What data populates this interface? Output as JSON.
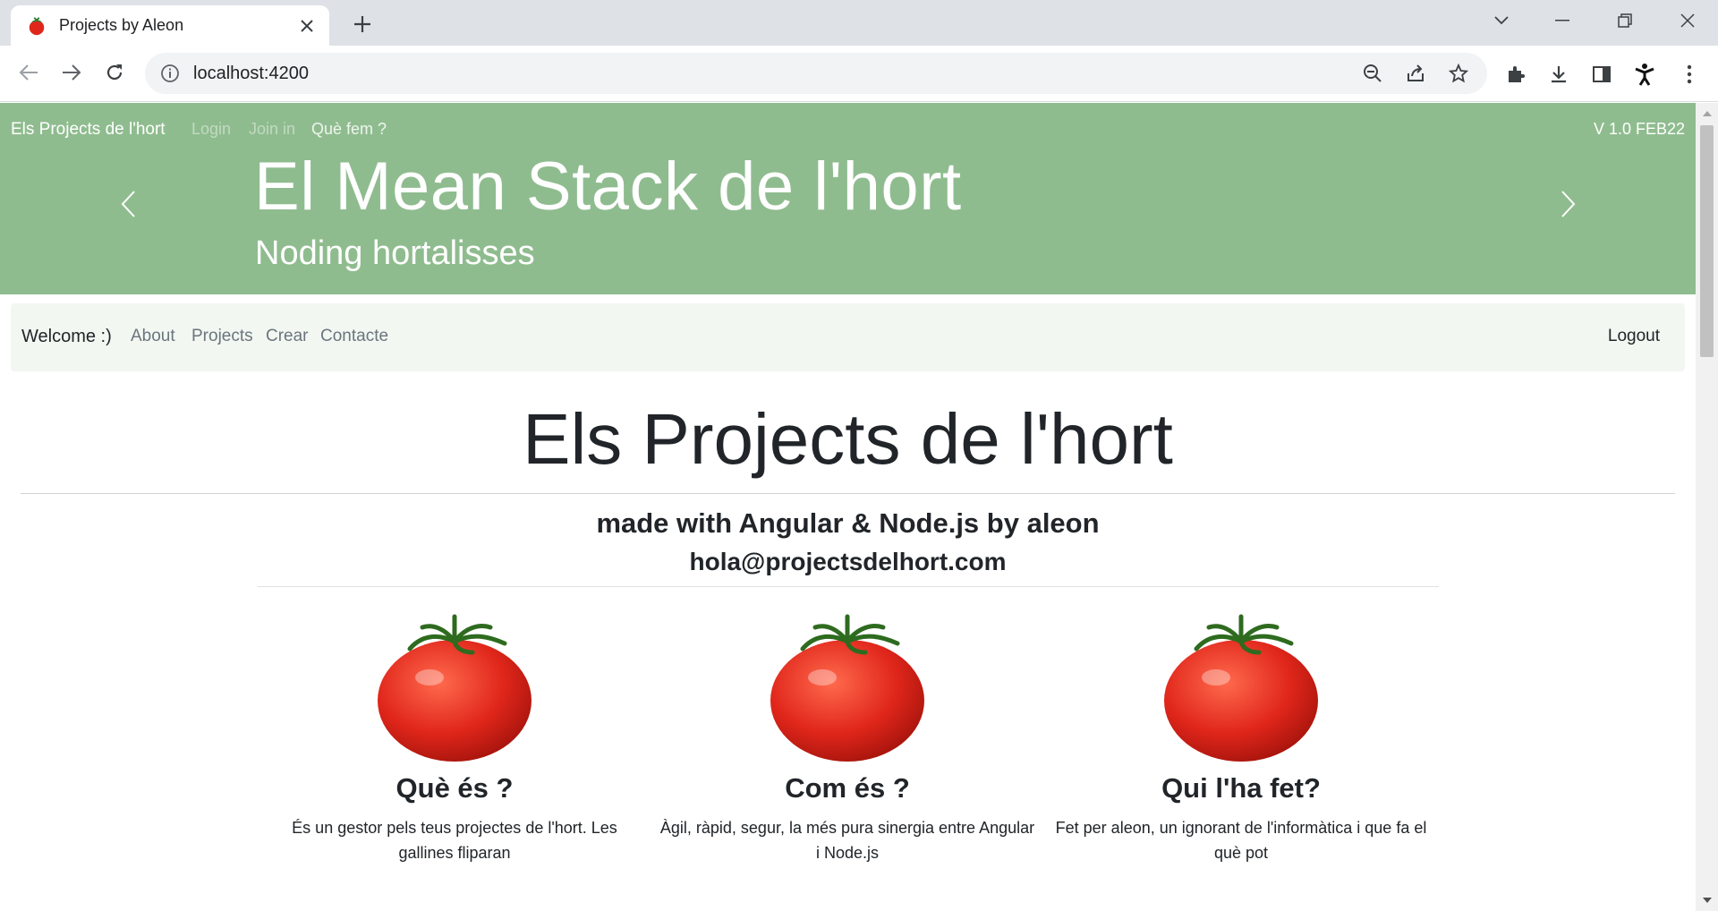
{
  "browser": {
    "tab_title": "Projects by Aleon",
    "url": "localhost:4200",
    "icons": [
      "tomato-favicon",
      "close-icon",
      "plus-icon",
      "chevron-down-icon",
      "minimize-icon",
      "restore-icon",
      "close-window-icon",
      "back-icon",
      "forward-icon",
      "reload-icon",
      "info-icon",
      "zoom-out-icon",
      "share-icon",
      "star-icon",
      "puzzle-icon",
      "download-icon",
      "sidepanel-icon",
      "profile-icon",
      "menu-dots-icon"
    ]
  },
  "hero": {
    "brand": "Els Projects de l'hort",
    "links": {
      "login": "Login",
      "join": "Join in",
      "about": "Què fem ?"
    },
    "version": "V 1.0 FEB22",
    "title": "El Mean Stack de l'hort",
    "subtitle": "Noding hortalisses",
    "bg_color": "#8fbc8f"
  },
  "navbar": {
    "brand": "Welcome :)",
    "links": [
      "About",
      "Projects",
      "Crear",
      "Contacte"
    ],
    "logout": "Logout"
  },
  "main": {
    "title": "Els Projects de l'hort",
    "made_with": "made with Angular & Node.js by aleon",
    "email": "hola@projectsdelhort.com",
    "features": [
      {
        "title": "Què és ?",
        "text": "És un gestor pels teus projectes de l'hort. Les gallines fliparan"
      },
      {
        "title": "Com és ?",
        "text": "Àgil, ràpid, segur, la més pura sinergia entre Angular i Node.js"
      },
      {
        "title": "Qui l'ha fet?",
        "text": "Fet per aleon, un ignorant de l'informàtica i que fa el què pot"
      }
    ]
  }
}
